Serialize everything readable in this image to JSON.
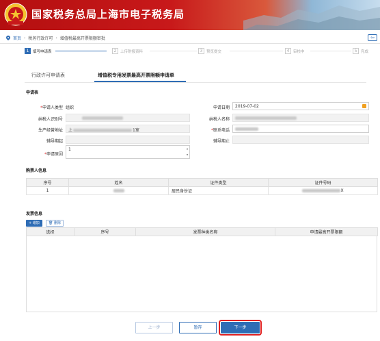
{
  "banner": {
    "title": "国家税务总局上海市电子税务局"
  },
  "breadcrumb": {
    "home": "首页",
    "level1": "税务行政许可",
    "level2": "增值税最高开票限额审批"
  },
  "steps": [
    {
      "num": "1",
      "label": "填写申请表"
    },
    {
      "num": "2",
      "label": "上传附报资料"
    },
    {
      "num": "3",
      "label": "预览提交"
    },
    {
      "num": "4",
      "label": "审核中"
    },
    {
      "num": "5",
      "label": "完成"
    }
  ],
  "tabs": {
    "tab1": "行政许可申请表",
    "tab2": "增值税专用发票最高开票限额申请单"
  },
  "form": {
    "section_title": "申请表",
    "applicant_type_label": "申请人类型",
    "applicant_type_value": "组织",
    "apply_date_label": "申请日期",
    "apply_date_value": "2019-07-02",
    "taxpayer_id_label": "纳税人识别号",
    "taxpayer_name_label": "纳税人名称",
    "address_label": "生产经营地址",
    "address_prefix": "上",
    "address_suffix": "1室",
    "phone_label": "联系电话",
    "guide_start_label": "辅导期起",
    "guide_end_label": "辅导期止",
    "reason_label": "申请原因",
    "reason_value": "1"
  },
  "buyer": {
    "section_title": "购票人信息",
    "columns": [
      "序号",
      "姓名",
      "证件类型",
      "证件号码"
    ],
    "rows": [
      {
        "seq": "1",
        "id_type": "居民身份证",
        "id_suffix": "X"
      }
    ]
  },
  "invoice": {
    "section_title": "发票信息",
    "add_label": "增加",
    "delete_label": "删除",
    "columns": [
      "选择",
      "序号",
      "发票种类名称",
      "申请最高开票限额"
    ]
  },
  "footer": {
    "prev": "上一步",
    "save": "暂存",
    "next": "下一步"
  },
  "colors": {
    "accent": "#2f6db5",
    "banner_red": "#c8191a",
    "required": "#e03030",
    "highlight_border": "#e02020"
  }
}
